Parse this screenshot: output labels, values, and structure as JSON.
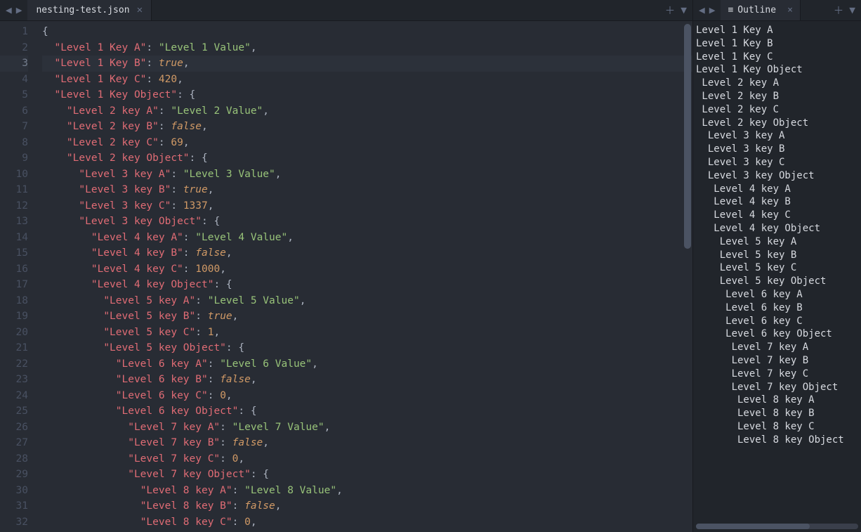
{
  "editor": {
    "filename": "nesting-test.json",
    "current_line": 3,
    "lines": [
      {
        "n": 1,
        "tokens": [
          {
            "t": "{",
            "c": "p"
          }
        ]
      },
      {
        "n": 2,
        "tokens": [
          {
            "t": "  ",
            "c": "p"
          },
          {
            "t": "\"Level 1 Key A\"",
            "c": "k"
          },
          {
            "t": ": ",
            "c": "p"
          },
          {
            "t": "\"Level 1 Value\"",
            "c": "s"
          },
          {
            "t": ",",
            "c": "p"
          }
        ]
      },
      {
        "n": 3,
        "tokens": [
          {
            "t": "  ",
            "c": "p"
          },
          {
            "t": "\"Level 1 Key B\"",
            "c": "k"
          },
          {
            "t": ": ",
            "c": "p"
          },
          {
            "t": "true",
            "c": "b"
          },
          {
            "t": ",",
            "c": "p"
          }
        ]
      },
      {
        "n": 4,
        "tokens": [
          {
            "t": "  ",
            "c": "p"
          },
          {
            "t": "\"Level 1 Key C\"",
            "c": "k"
          },
          {
            "t": ": ",
            "c": "p"
          },
          {
            "t": "420",
            "c": "n"
          },
          {
            "t": ",",
            "c": "p"
          }
        ]
      },
      {
        "n": 5,
        "tokens": [
          {
            "t": "  ",
            "c": "p"
          },
          {
            "t": "\"Level 1 Key Object\"",
            "c": "k"
          },
          {
            "t": ": {",
            "c": "p"
          }
        ]
      },
      {
        "n": 6,
        "tokens": [
          {
            "t": "    ",
            "c": "p"
          },
          {
            "t": "\"Level 2 key A\"",
            "c": "k"
          },
          {
            "t": ": ",
            "c": "p"
          },
          {
            "t": "\"Level 2 Value\"",
            "c": "s"
          },
          {
            "t": ",",
            "c": "p"
          }
        ]
      },
      {
        "n": 7,
        "tokens": [
          {
            "t": "    ",
            "c": "p"
          },
          {
            "t": "\"Level 2 key B\"",
            "c": "k"
          },
          {
            "t": ": ",
            "c": "p"
          },
          {
            "t": "false",
            "c": "b"
          },
          {
            "t": ",",
            "c": "p"
          }
        ]
      },
      {
        "n": 8,
        "tokens": [
          {
            "t": "    ",
            "c": "p"
          },
          {
            "t": "\"Level 2 key C\"",
            "c": "k"
          },
          {
            "t": ": ",
            "c": "p"
          },
          {
            "t": "69",
            "c": "n"
          },
          {
            "t": ",",
            "c": "p"
          }
        ]
      },
      {
        "n": 9,
        "tokens": [
          {
            "t": "    ",
            "c": "p"
          },
          {
            "t": "\"Level 2 key Object\"",
            "c": "k"
          },
          {
            "t": ": {",
            "c": "p"
          }
        ]
      },
      {
        "n": 10,
        "tokens": [
          {
            "t": "      ",
            "c": "p"
          },
          {
            "t": "\"Level 3 key A\"",
            "c": "k"
          },
          {
            "t": ": ",
            "c": "p"
          },
          {
            "t": "\"Level 3 Value\"",
            "c": "s"
          },
          {
            "t": ",",
            "c": "p"
          }
        ]
      },
      {
        "n": 11,
        "tokens": [
          {
            "t": "      ",
            "c": "p"
          },
          {
            "t": "\"Level 3 key B\"",
            "c": "k"
          },
          {
            "t": ": ",
            "c": "p"
          },
          {
            "t": "true",
            "c": "b"
          },
          {
            "t": ",",
            "c": "p"
          }
        ]
      },
      {
        "n": 12,
        "tokens": [
          {
            "t": "      ",
            "c": "p"
          },
          {
            "t": "\"Level 3 key C\"",
            "c": "k"
          },
          {
            "t": ": ",
            "c": "p"
          },
          {
            "t": "1337",
            "c": "n"
          },
          {
            "t": ",",
            "c": "p"
          }
        ]
      },
      {
        "n": 13,
        "tokens": [
          {
            "t": "      ",
            "c": "p"
          },
          {
            "t": "\"Level 3 key Object\"",
            "c": "k"
          },
          {
            "t": ": {",
            "c": "p"
          }
        ]
      },
      {
        "n": 14,
        "tokens": [
          {
            "t": "        ",
            "c": "p"
          },
          {
            "t": "\"Level 4 key A\"",
            "c": "k"
          },
          {
            "t": ": ",
            "c": "p"
          },
          {
            "t": "\"Level 4 Value\"",
            "c": "s"
          },
          {
            "t": ",",
            "c": "p"
          }
        ]
      },
      {
        "n": 15,
        "tokens": [
          {
            "t": "        ",
            "c": "p"
          },
          {
            "t": "\"Level 4 key B\"",
            "c": "k"
          },
          {
            "t": ": ",
            "c": "p"
          },
          {
            "t": "false",
            "c": "b"
          },
          {
            "t": ",",
            "c": "p"
          }
        ]
      },
      {
        "n": 16,
        "tokens": [
          {
            "t": "        ",
            "c": "p"
          },
          {
            "t": "\"Level 4 key C\"",
            "c": "k"
          },
          {
            "t": ": ",
            "c": "p"
          },
          {
            "t": "1000",
            "c": "n"
          },
          {
            "t": ",",
            "c": "p"
          }
        ]
      },
      {
        "n": 17,
        "tokens": [
          {
            "t": "        ",
            "c": "p"
          },
          {
            "t": "\"Level 4 key Object\"",
            "c": "k"
          },
          {
            "t": ": {",
            "c": "p"
          }
        ]
      },
      {
        "n": 18,
        "tokens": [
          {
            "t": "          ",
            "c": "p"
          },
          {
            "t": "\"Level 5 key A\"",
            "c": "k"
          },
          {
            "t": ": ",
            "c": "p"
          },
          {
            "t": "\"Level 5 Value\"",
            "c": "s"
          },
          {
            "t": ",",
            "c": "p"
          }
        ]
      },
      {
        "n": 19,
        "tokens": [
          {
            "t": "          ",
            "c": "p"
          },
          {
            "t": "\"Level 5 key B\"",
            "c": "k"
          },
          {
            "t": ": ",
            "c": "p"
          },
          {
            "t": "true",
            "c": "b"
          },
          {
            "t": ",",
            "c": "p"
          }
        ]
      },
      {
        "n": 20,
        "tokens": [
          {
            "t": "          ",
            "c": "p"
          },
          {
            "t": "\"Level 5 key C\"",
            "c": "k"
          },
          {
            "t": ": ",
            "c": "p"
          },
          {
            "t": "1",
            "c": "n"
          },
          {
            "t": ",",
            "c": "p"
          }
        ]
      },
      {
        "n": 21,
        "tokens": [
          {
            "t": "          ",
            "c": "p"
          },
          {
            "t": "\"Level 5 key Object\"",
            "c": "k"
          },
          {
            "t": ": {",
            "c": "p"
          }
        ]
      },
      {
        "n": 22,
        "tokens": [
          {
            "t": "            ",
            "c": "p"
          },
          {
            "t": "\"Level 6 key A\"",
            "c": "k"
          },
          {
            "t": ": ",
            "c": "p"
          },
          {
            "t": "\"Level 6 Value\"",
            "c": "s"
          },
          {
            "t": ",",
            "c": "p"
          }
        ]
      },
      {
        "n": 23,
        "tokens": [
          {
            "t": "            ",
            "c": "p"
          },
          {
            "t": "\"Level 6 key B\"",
            "c": "k"
          },
          {
            "t": ": ",
            "c": "p"
          },
          {
            "t": "false",
            "c": "b"
          },
          {
            "t": ",",
            "c": "p"
          }
        ]
      },
      {
        "n": 24,
        "tokens": [
          {
            "t": "            ",
            "c": "p"
          },
          {
            "t": "\"Level 6 key C\"",
            "c": "k"
          },
          {
            "t": ": ",
            "c": "p"
          },
          {
            "t": "0",
            "c": "n"
          },
          {
            "t": ",",
            "c": "p"
          }
        ]
      },
      {
        "n": 25,
        "tokens": [
          {
            "t": "            ",
            "c": "p"
          },
          {
            "t": "\"Level 6 key Object\"",
            "c": "k"
          },
          {
            "t": ": {",
            "c": "p"
          }
        ]
      },
      {
        "n": 26,
        "tokens": [
          {
            "t": "              ",
            "c": "p"
          },
          {
            "t": "\"Level 7 key A\"",
            "c": "k"
          },
          {
            "t": ": ",
            "c": "p"
          },
          {
            "t": "\"Level 7 Value\"",
            "c": "s"
          },
          {
            "t": ",",
            "c": "p"
          }
        ]
      },
      {
        "n": 27,
        "tokens": [
          {
            "t": "              ",
            "c": "p"
          },
          {
            "t": "\"Level 7 key B\"",
            "c": "k"
          },
          {
            "t": ": ",
            "c": "p"
          },
          {
            "t": "false",
            "c": "b"
          },
          {
            "t": ",",
            "c": "p"
          }
        ]
      },
      {
        "n": 28,
        "tokens": [
          {
            "t": "              ",
            "c": "p"
          },
          {
            "t": "\"Level 7 key C\"",
            "c": "k"
          },
          {
            "t": ": ",
            "c": "p"
          },
          {
            "t": "0",
            "c": "n"
          },
          {
            "t": ",",
            "c": "p"
          }
        ]
      },
      {
        "n": 29,
        "tokens": [
          {
            "t": "              ",
            "c": "p"
          },
          {
            "t": "\"Level 7 key Object\"",
            "c": "k"
          },
          {
            "t": ": {",
            "c": "p"
          }
        ]
      },
      {
        "n": 30,
        "tokens": [
          {
            "t": "                ",
            "c": "p"
          },
          {
            "t": "\"Level 8 key A\"",
            "c": "k"
          },
          {
            "t": ": ",
            "c": "p"
          },
          {
            "t": "\"Level 8 Value\"",
            "c": "s"
          },
          {
            "t": ",",
            "c": "p"
          }
        ]
      },
      {
        "n": 31,
        "tokens": [
          {
            "t": "                ",
            "c": "p"
          },
          {
            "t": "\"Level 8 key B\"",
            "c": "k"
          },
          {
            "t": ": ",
            "c": "p"
          },
          {
            "t": "false",
            "c": "b"
          },
          {
            "t": ",",
            "c": "p"
          }
        ]
      },
      {
        "n": 32,
        "tokens": [
          {
            "t": "                ",
            "c": "p"
          },
          {
            "t": "\"Level 8 key C\"",
            "c": "k"
          },
          {
            "t": ": ",
            "c": "p"
          },
          {
            "t": "0",
            "c": "n"
          },
          {
            "t": ",",
            "c": "p"
          }
        ]
      }
    ]
  },
  "outline": {
    "title": "Outline",
    "items": [
      {
        "label": "Level 1 Key A",
        "depth": 0
      },
      {
        "label": "Level 1 Key B",
        "depth": 0
      },
      {
        "label": "Level 1 Key C",
        "depth": 0
      },
      {
        "label": "Level 1 Key Object",
        "depth": 0
      },
      {
        "label": "Level 2 key A",
        "depth": 1
      },
      {
        "label": "Level 2 key B",
        "depth": 1
      },
      {
        "label": "Level 2 key C",
        "depth": 1
      },
      {
        "label": "Level 2 key Object",
        "depth": 1
      },
      {
        "label": "Level 3 key A",
        "depth": 2
      },
      {
        "label": "Level 3 key B",
        "depth": 2
      },
      {
        "label": "Level 3 key C",
        "depth": 2
      },
      {
        "label": "Level 3 key Object",
        "depth": 2
      },
      {
        "label": "Level 4 key A",
        "depth": 3
      },
      {
        "label": "Level 4 key B",
        "depth": 3
      },
      {
        "label": "Level 4 key C",
        "depth": 3
      },
      {
        "label": "Level 4 key Object",
        "depth": 3
      },
      {
        "label": "Level 5 key A",
        "depth": 4
      },
      {
        "label": "Level 5 key B",
        "depth": 4
      },
      {
        "label": "Level 5 key C",
        "depth": 4
      },
      {
        "label": "Level 5 key Object",
        "depth": 4
      },
      {
        "label": "Level 6 key A",
        "depth": 5
      },
      {
        "label": "Level 6 key B",
        "depth": 5
      },
      {
        "label": "Level 6 key C",
        "depth": 5
      },
      {
        "label": "Level 6 key Object",
        "depth": 5
      },
      {
        "label": "Level 7 key A",
        "depth": 6
      },
      {
        "label": "Level 7 key B",
        "depth": 6
      },
      {
        "label": "Level 7 key C",
        "depth": 6
      },
      {
        "label": "Level 7 key Object",
        "depth": 6
      },
      {
        "label": "Level 8 key A",
        "depth": 7
      },
      {
        "label": "Level 8 key B",
        "depth": 7
      },
      {
        "label": "Level 8 key C",
        "depth": 7
      },
      {
        "label": "Level 8 key Object",
        "depth": 7
      }
    ]
  }
}
